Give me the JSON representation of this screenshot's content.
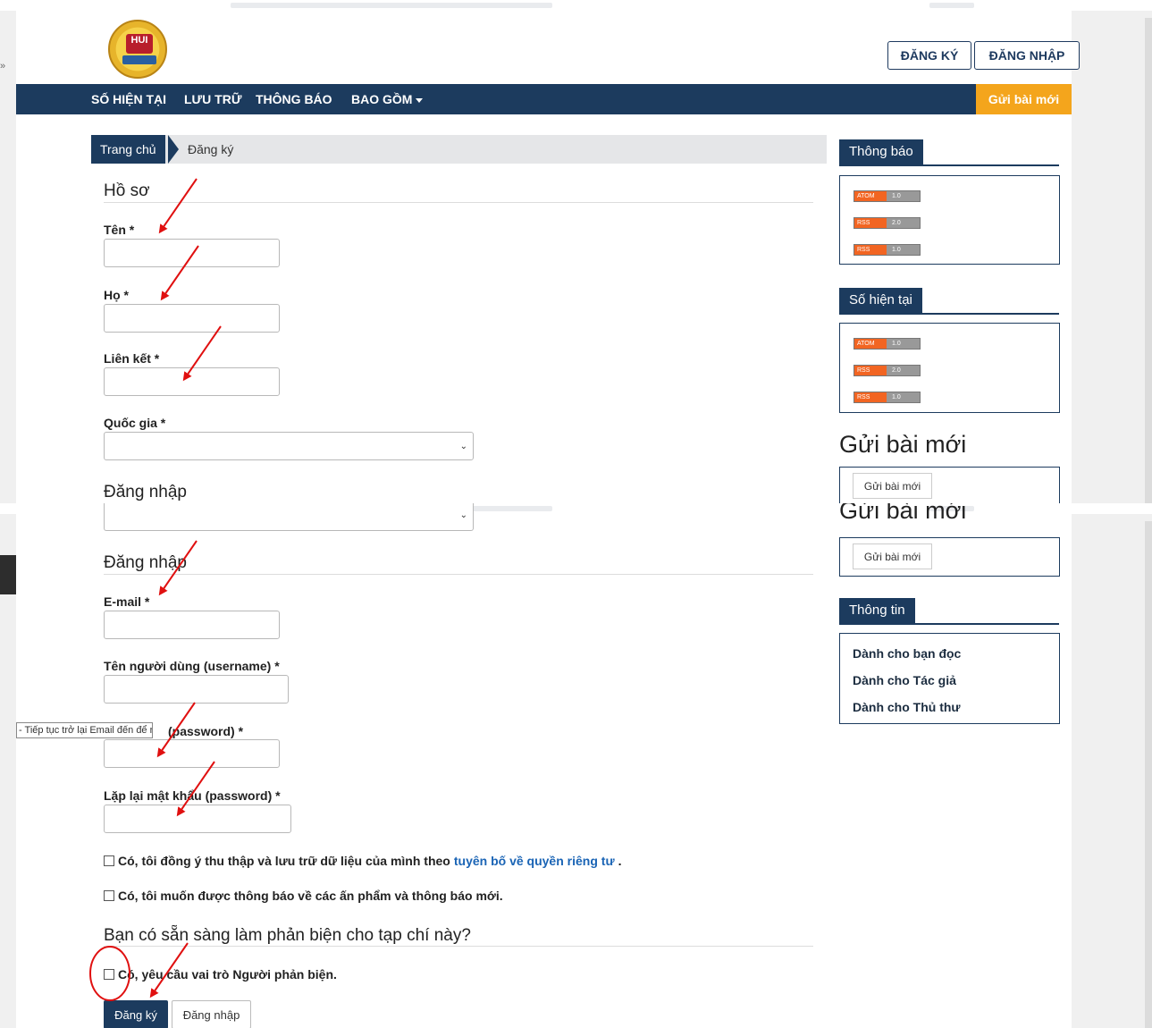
{
  "header": {
    "register_button": "ĐĂNG KÝ",
    "login_button": "ĐĂNG NHẬP",
    "logo_text": "HUI"
  },
  "navbar": {
    "items": [
      "SỐ HIỆN TẠI",
      "LƯU TRỮ",
      "THÔNG BÁO",
      "BAO GỒM"
    ],
    "submit_new": "Gửi bài mới"
  },
  "breadcrumb": {
    "home": "Trang chủ",
    "current": "Đăng ký"
  },
  "profile": {
    "section_title": "Hồ sơ",
    "first_name_label": "Tên *",
    "last_name_label": "Họ *",
    "affiliation_label": "Liên kết *",
    "country_label": "Quốc gia *"
  },
  "login": {
    "section_title": "Đăng nhập",
    "email_label": "E-mail *",
    "username_label": "Tên người dùng (username) *",
    "password_label_partial": "(password) *",
    "repeat_password_label": "Lặp lại mật khẩu (password) *"
  },
  "tooltip": "- Tiếp tục trở lại Email đến để n...",
  "consent": {
    "privacy_prefix": "Có, tôi đồng ý thu thập và lưu trữ dữ liệu của mình theo",
    "privacy_link": "tuyên bố về quyền riêng tư",
    "privacy_suffix": ".",
    "notify": "Có, tôi muốn được thông báo về các ấn phẩm và thông báo mới."
  },
  "reviewer": {
    "section_title": "Bạn có sẵn sàng làm phản biện cho tạp chí này?",
    "request_role": "Có, yêu cầu vai trò Người phản biện."
  },
  "actions": {
    "register": "Đăng ký",
    "login": "Đăng nhập"
  },
  "sidebar": {
    "announcements_title": "Thông báo",
    "current_issue_title": "Số hiện tại",
    "feeds": [
      {
        "kind": "ATOM",
        "version": "1.0"
      },
      {
        "kind": "RSS",
        "version": "2.0"
      },
      {
        "kind": "RSS",
        "version": "1.0"
      }
    ],
    "submit_title": "Gửi bài mới",
    "submit_button": "Gửi bài mới",
    "info_title": "Thông tin",
    "info_links": [
      "Dành cho bạn đọc",
      "Dành cho Tác giả",
      "Dành cho Thủ thư"
    ]
  },
  "colors": {
    "navy": "#1c3b5e",
    "accent_orange": "#f4a51c",
    "link_blue": "#1a64b5",
    "annotation_red": "#e01010"
  }
}
